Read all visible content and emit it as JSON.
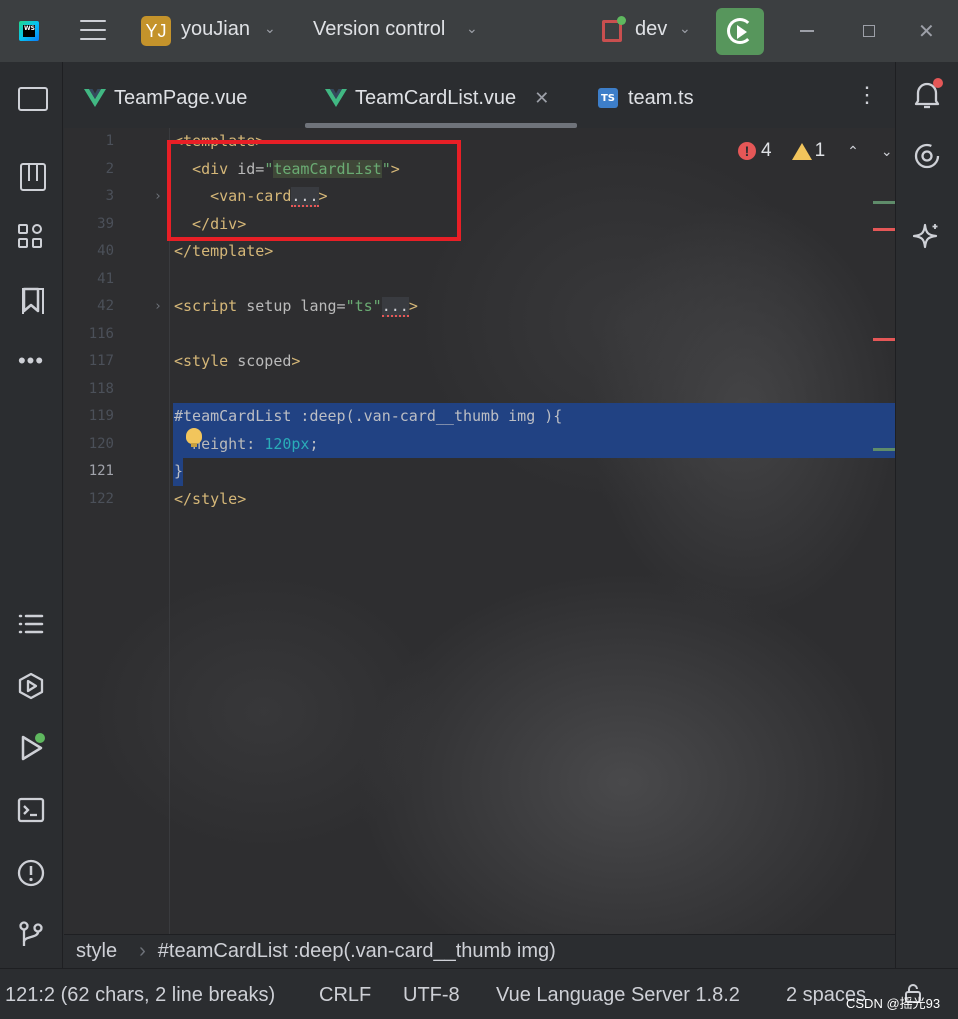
{
  "titlebar": {
    "logo_text": "WS",
    "project_initials": "YJ",
    "project_name": "youJian",
    "version_control": "Version control",
    "branch": "dev"
  },
  "tabs": [
    {
      "label": "TeamPage.vue",
      "type": "vue"
    },
    {
      "label": "TeamCardList.vue",
      "type": "vue",
      "active": true
    },
    {
      "label": "team.ts",
      "type": "ts",
      "icon_text": "TS"
    }
  ],
  "inspections": {
    "errors": "4",
    "warnings": "1"
  },
  "code": {
    "lines": [
      {
        "num": "1",
        "text": "<template>"
      },
      {
        "num": "2",
        "text": "  <div id=\"teamCardList\">"
      },
      {
        "num": "3",
        "text": "    <van-card...>"
      },
      {
        "num": "39",
        "text": "  </div>"
      },
      {
        "num": "40",
        "text": "</template>"
      },
      {
        "num": "41",
        "text": ""
      },
      {
        "num": "42",
        "text": "<script setup lang=\"ts\"...>"
      },
      {
        "num": "116",
        "text": ""
      },
      {
        "num": "117",
        "text": "<style scoped>"
      },
      {
        "num": "118",
        "text": ""
      },
      {
        "num": "119",
        "text": "#teamCardList :deep(.van-card__thumb img ){"
      },
      {
        "num": "120",
        "text": "  height: 120px;"
      },
      {
        "num": "121",
        "text": "}"
      },
      {
        "num": "122",
        "text": "</style>"
      }
    ],
    "current_line": "121"
  },
  "breadcrumb": [
    "style",
    "#teamCardList :deep(.van-card__thumb img)"
  ],
  "statusbar": {
    "position": "121:2 (62 chars, 2 line breaks)",
    "line_ending": "CRLF",
    "encoding": "UTF-8",
    "language_server": "Vue Language Server 1.8.2",
    "indent": "2 spaces"
  },
  "watermark": "CSDN @摇光93",
  "colors": {
    "accent_run": "#57965c",
    "error": "#e55757",
    "warning": "#f2c55c",
    "selection": "#214283",
    "highlight_box": "#e81f26"
  }
}
